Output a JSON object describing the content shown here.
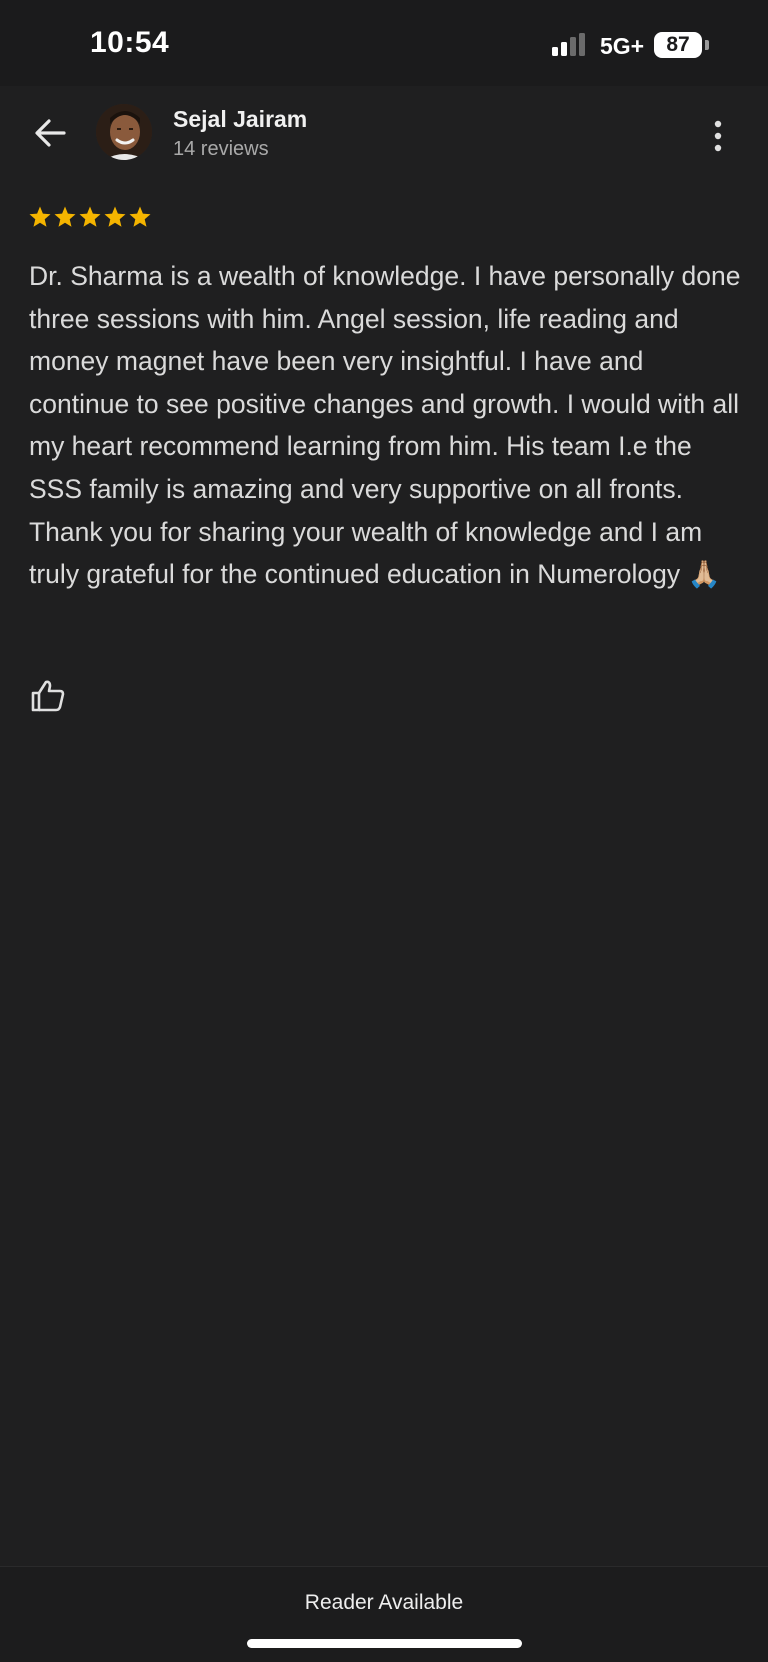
{
  "status_bar": {
    "time": "10:54",
    "network": "5G+",
    "battery": "87"
  },
  "review": {
    "reviewer_name": "Sejal Jairam",
    "review_count": "14 reviews",
    "rating": 5,
    "star_color": "#f4b400",
    "text": "Dr. Sharma is a wealth of knowledge. I have personally done three sessions with him. Angel session, life reading and money magnet have been very insightful. I have and continue to see positive changes and growth. I would with all my heart recommend learning from him. His team I.e the SSS family is amazing and very supportive on all fronts. Thank you for sharing your wealth of knowledge and I am truly grateful for the continued education in Numerology 🙏🏼"
  },
  "icons": {
    "back": "back-arrow-icon",
    "more": "more-vertical-icon",
    "like": "thumbs-up-icon"
  },
  "bottom_bar": {
    "reader_label": "Reader Available"
  }
}
